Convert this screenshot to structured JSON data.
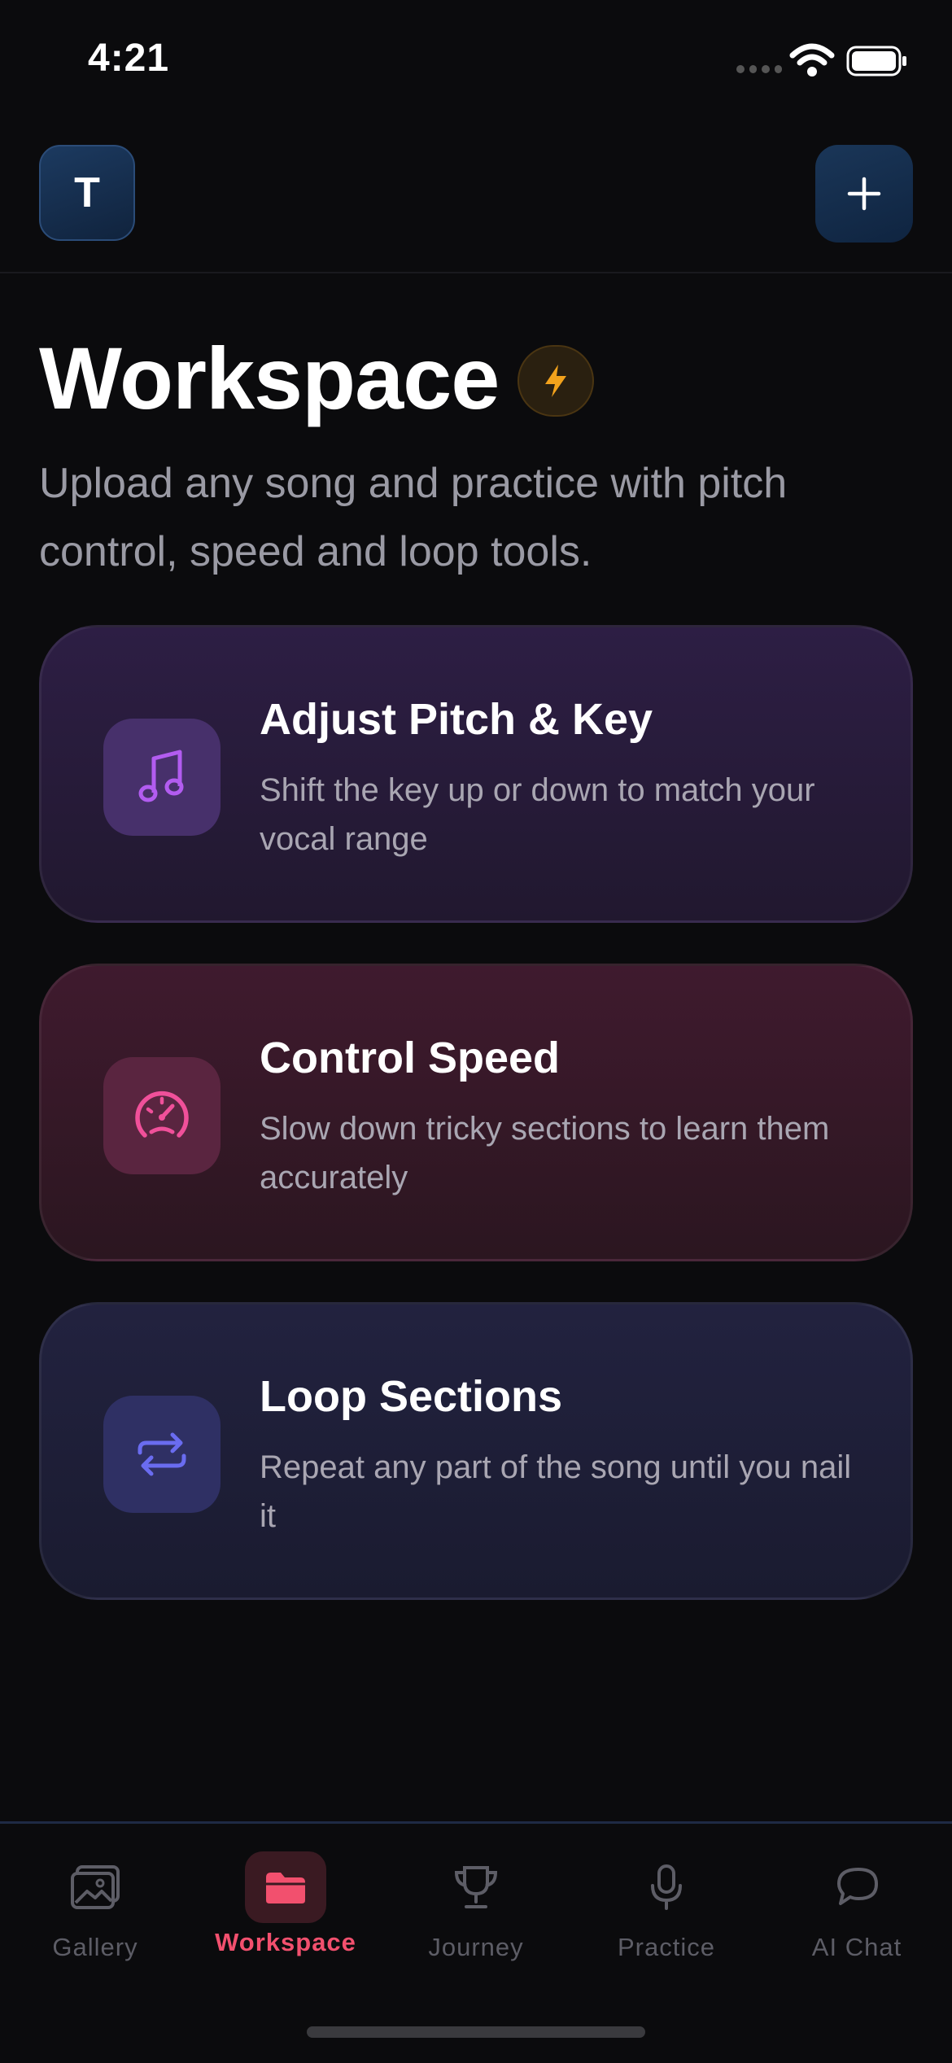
{
  "status_bar": {
    "time": "4:21"
  },
  "header": {
    "avatar_initial": "T"
  },
  "page": {
    "title": "Workspace",
    "subtitle": "Upload any song and practice with pitch control, speed and loop tools."
  },
  "cards": [
    {
      "title": "Adjust Pitch & Key",
      "description": "Shift the key up or down to match your vocal range",
      "icon": "music-note-icon",
      "accent": "#b25cf0"
    },
    {
      "title": "Control Speed",
      "description": "Slow down tricky sections to learn them accurately",
      "icon": "speedometer-icon",
      "accent": "#f0509a"
    },
    {
      "title": "Loop Sections",
      "description": "Repeat any part of the song until you nail it",
      "icon": "repeat-icon",
      "accent": "#6a6cf0"
    }
  ],
  "tabs": [
    {
      "label": "Gallery",
      "icon": "gallery-icon",
      "active": false
    },
    {
      "label": "Workspace",
      "icon": "folder-icon",
      "active": true
    },
    {
      "label": "Journey",
      "icon": "trophy-icon",
      "active": false
    },
    {
      "label": "Practice",
      "icon": "microphone-icon",
      "active": false
    },
    {
      "label": "AI Chat",
      "icon": "chat-bubble-icon",
      "active": false
    }
  ],
  "colors": {
    "active_tab": "#f2506e",
    "bolt": "#f2a21c"
  }
}
